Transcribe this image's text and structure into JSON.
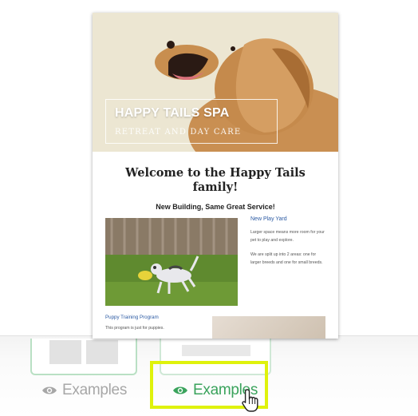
{
  "email": {
    "hero_title": "HAPPY TAILS SPA",
    "hero_subtitle": "RETREAT AND DAY CARE",
    "welcome_heading": "Welcome to the Happy Tails family!",
    "tagline": "New Building, Same Great Service!",
    "side_title": "New Play Yard",
    "side_paragraph_1": "Larger space means more room for your pet to play and explore.",
    "side_paragraph_2": "We are split up into 2 areas: one for larger breeds and one for small breeds.",
    "program_title": "Puppy Training Program",
    "program_text": "This program is just for puppies."
  },
  "cards": {
    "left_label": "Examples",
    "right_label": "Examples"
  },
  "icons": {
    "left_eye": "eye-icon",
    "right_eye": "eye-icon",
    "cursor": "hand-pointer-icon"
  },
  "colors": {
    "accent_green": "#3aa35c",
    "muted_gray": "#a7a7a7",
    "highlight_yellow": "#dff20c",
    "link_blue": "#2b5aa3"
  }
}
